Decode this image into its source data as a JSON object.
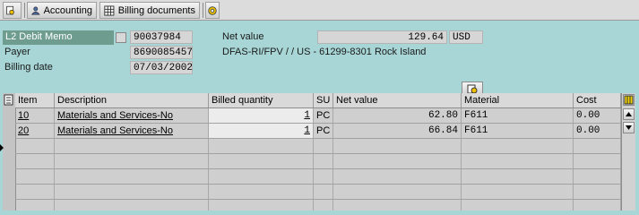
{
  "toolbar": {
    "accounting_label": "Accounting",
    "billing_docs_label": "Billing documents"
  },
  "header": {
    "doc_type": "L2 Debit Memo",
    "doc_number": "90037984",
    "payer_label": "Payer",
    "payer_value": "8690085457",
    "billing_date_label": "Billing date",
    "billing_date_value": "07/03/2002",
    "net_value_label": "Net value",
    "net_value": "129.64",
    "currency": "USD",
    "payer_name": "DFAS-RI/FPV / / US - 61299-8301 Rock Island"
  },
  "table": {
    "columns": [
      "Item",
      "Description",
      "Billed quantity",
      "SU",
      "Net value",
      "Material",
      "Cost"
    ],
    "rows": [
      {
        "item": "10",
        "description": "Materials and Services-No",
        "qty": "1",
        "su": "PC",
        "net": "62.80",
        "material": "F611",
        "cost": "0.00"
      },
      {
        "item": "20",
        "description": "Materials and Services-No",
        "qty": "1",
        "su": "PC",
        "net": "66.84",
        "material": "F611",
        "cost": "0.00"
      }
    ]
  },
  "icons": {
    "toolbar_first": "display-document-icon",
    "accounting": "person-icon",
    "billing_documents": "table-grid-icon",
    "last": "gear-icon",
    "column_config": "table-settings-icon"
  }
}
